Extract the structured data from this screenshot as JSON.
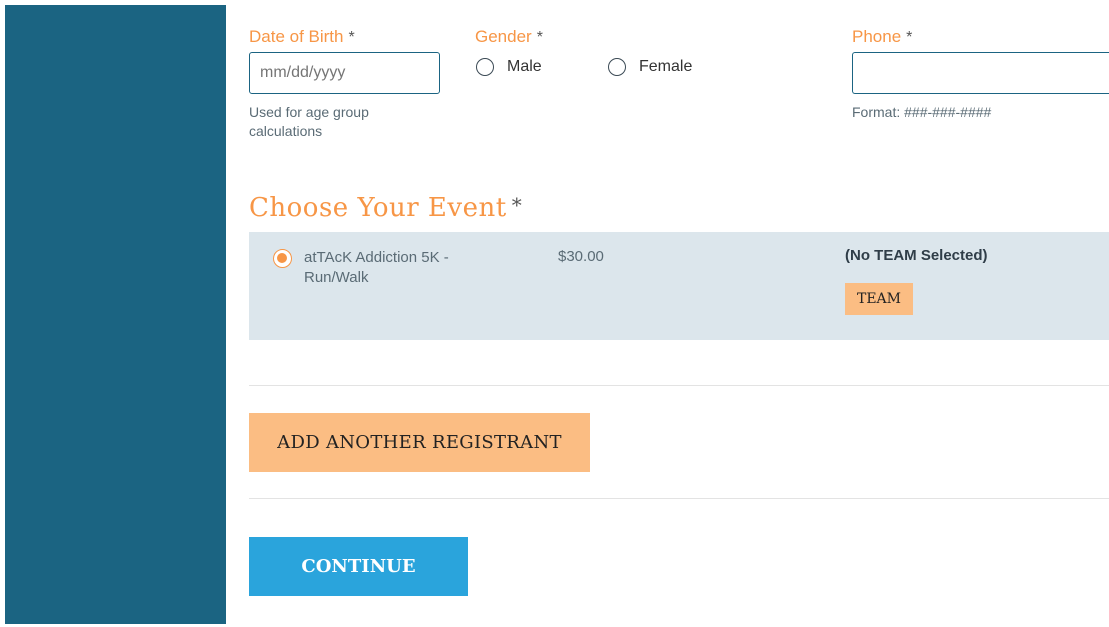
{
  "form": {
    "dob": {
      "label": "Date of Birth",
      "required_mark": "*",
      "placeholder": "mm/dd/yyyy",
      "help": "Used for age group calculations"
    },
    "gender": {
      "label": "Gender",
      "required_mark": "*",
      "options": [
        "Male",
        "Female"
      ]
    },
    "phone": {
      "label": "Phone",
      "required_mark": "*",
      "value": "",
      "help": "Format: ###-###-####"
    }
  },
  "event_section": {
    "title": "Choose Your Event",
    "required_mark": "*",
    "event": {
      "name": "atTAcK Addiction 5K - Run/Walk",
      "price": "$30.00",
      "team_status": "(No TEAM Selected)",
      "team_button": "TEAM",
      "selected": true
    }
  },
  "buttons": {
    "add_registrant": "ADD ANOTHER REGISTRANT",
    "continue": "CONTINUE"
  },
  "colors": {
    "sidebar": "#1b6482",
    "accent_orange": "#f79646",
    "button_orange": "#fbbd83",
    "button_blue": "#2aa4dc",
    "event_bg": "#dce6ec"
  }
}
